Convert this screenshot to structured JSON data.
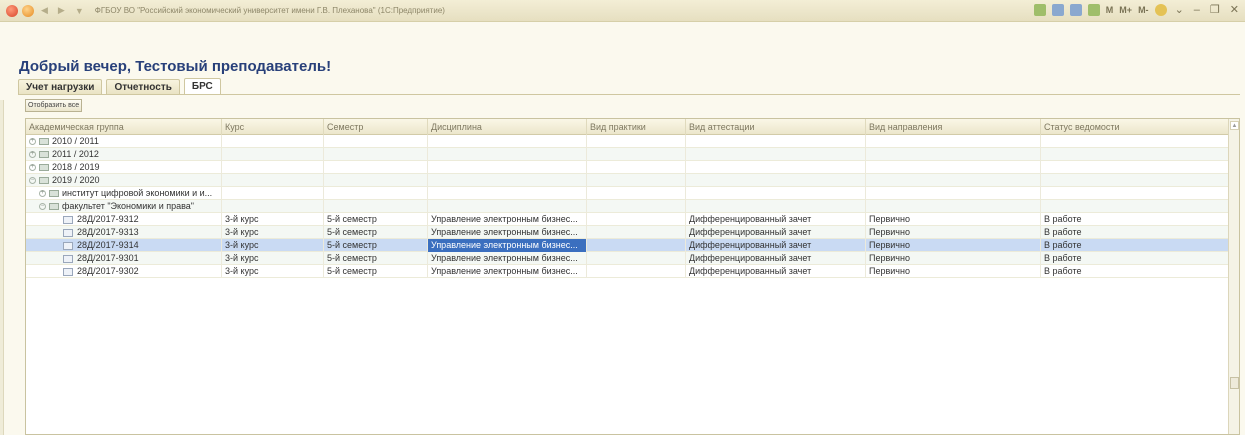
{
  "window": {
    "title": "ФГБОУ ВО \"Российский экономический университет имени Г.В. Плеханова\" (1С:Предприятие)",
    "toolbar_labels": [
      "M",
      "M+",
      "M-"
    ]
  },
  "greeting": "Добрый вечер, Тестовый преподаватель!",
  "tabs": [
    {
      "label": "Учет нагрузки"
    },
    {
      "label": "Отчетность"
    },
    {
      "label": "БРС"
    }
  ],
  "show_all_label": "Отобразить все",
  "table": {
    "columns": [
      "Академическая группа",
      "Курс",
      "Семестр",
      "Дисциплина",
      "Вид практики",
      "Вид аттестации",
      "Вид направления",
      "Статус ведомости"
    ],
    "tree_rows": [
      {
        "name": "2010 / 2011"
      },
      {
        "name": "2011 / 2012"
      },
      {
        "name": "2018 / 2019"
      },
      {
        "name": "2019 / 2020"
      },
      {
        "name": "институт цифровой экономики и и..."
      },
      {
        "name": "факультет \"Экономики и права\""
      }
    ],
    "rows": [
      {
        "group": "28Д/2017-9312",
        "course": "3-й курс",
        "semester": "5-й семестр",
        "discipline": "Управление электронным бизнес...",
        "practice": "",
        "attestation": "Дифференцированный зачет",
        "direction": "Первично",
        "status": "В работе"
      },
      {
        "group": "28Д/2017-9313",
        "course": "3-й курс",
        "semester": "5-й семестр",
        "discipline": "Управление электронным бизнес...",
        "practice": "",
        "attestation": "Дифференцированный зачет",
        "direction": "Первично",
        "status": "В работе"
      },
      {
        "group": "28Д/2017-9314",
        "course": "3-й курс",
        "semester": "5-й семестр",
        "discipline": "Управление электронным бизнес...",
        "practice": "",
        "attestation": "Дифференцированный зачет",
        "direction": "Первично",
        "status": "В работе"
      },
      {
        "group": "28Д/2017-9301",
        "course": "3-й курс",
        "semester": "5-й семестр",
        "discipline": "Управление электронным бизнес...",
        "practice": "",
        "attestation": "Дифференцированный зачет",
        "direction": "Первично",
        "status": "В работе"
      },
      {
        "group": "28Д/2017-9302",
        "course": "3-й курс",
        "semester": "5-й семестр",
        "discipline": "Управление электронным бизнес...",
        "practice": "",
        "attestation": "Дифференцированный зачет",
        "direction": "Первично",
        "status": "В работе"
      }
    ]
  },
  "colors": {
    "background": "#fbf9ee",
    "greeting": "#28407a",
    "selected_row": "#c9daf3",
    "current_cell": "#3b6fbf"
  }
}
